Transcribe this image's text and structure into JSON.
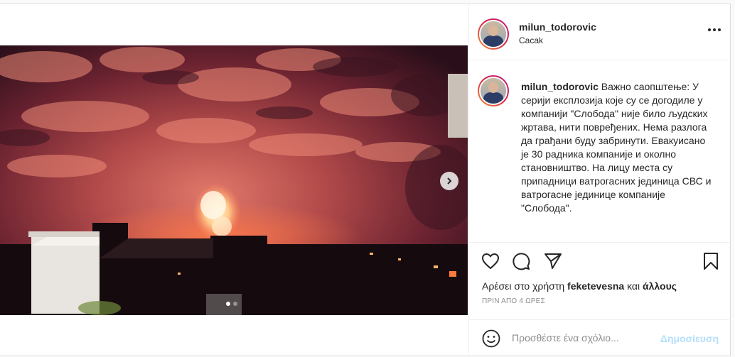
{
  "header": {
    "username": "milun_todorovic",
    "location": "Cacak"
  },
  "caption": {
    "username": "milun_todorovic",
    "text": "Важно саопштење: У серији експлозија које су се догодиле у компанији \"Слобода\" није било људских жртава, нити повређених. Нема разлога да грађани буду забринути. Евакуисано је 30 радника компаније и околно становништво. На лицу места су припадници ватрогасних јединица СВС и ватрогасне јединице компаније \"Слобода\"."
  },
  "likes": {
    "prefix": "Αρέσει στο χρήστη",
    "user": "feketevesna",
    "joiner": "και",
    "others": "άλλους"
  },
  "timestamp": "ΠΡΙΝ ΑΠΟ 4 ΩΡΕΣ",
  "comment": {
    "placeholder": "Προσθέστε ένα σχόλιο...",
    "post_label": "Δημοσίευση"
  },
  "icons": {
    "like": "heart-icon",
    "comment": "comment-icon",
    "share": "paper-plane-icon",
    "save": "bookmark-icon",
    "more": "more-options-icon",
    "next": "chevron-right-icon",
    "emoji": "emoji-icon"
  },
  "colors": {
    "accent_disabled": "#b2dffc",
    "secondary_text": "#8e8e8e",
    "border": "#dbdbdb"
  },
  "carousel": {
    "count": 2,
    "active": 1
  }
}
